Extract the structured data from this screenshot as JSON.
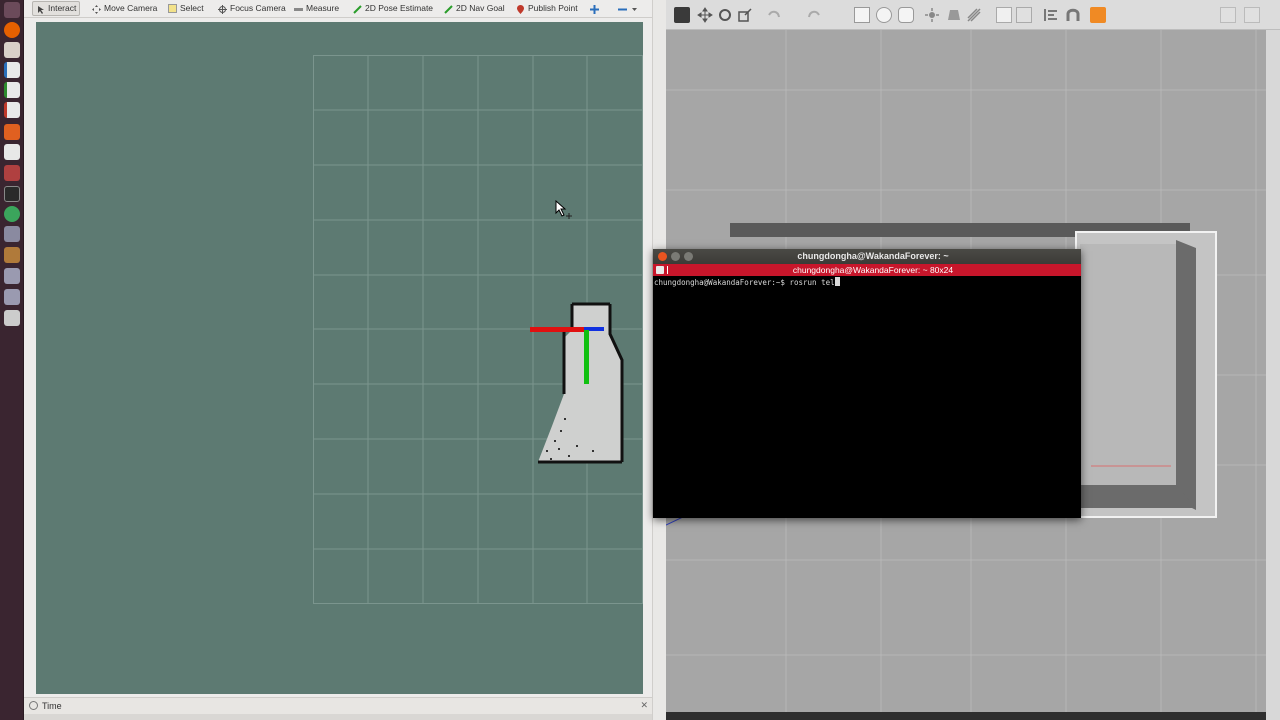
{
  "rviz": {
    "tools": [
      {
        "label": "Interact",
        "icon": "interact-icon"
      },
      {
        "label": "Move Camera",
        "icon": "move-camera-icon"
      },
      {
        "label": "Select",
        "icon": "select-icon"
      },
      {
        "label": "Focus Camera",
        "icon": "focus-camera-icon"
      },
      {
        "label": "Measure",
        "icon": "measure-icon"
      },
      {
        "label": "2D Pose Estimate",
        "icon": "pose-estimate-icon"
      },
      {
        "label": "2D Nav Goal",
        "icon": "nav-goal-icon"
      },
      {
        "label": "Publish Point",
        "icon": "publish-point-icon"
      }
    ],
    "time_panel": {
      "label": "Time"
    }
  },
  "terminal": {
    "window_title": "chungdongha@WakandaForever: ~",
    "tab_title": "chungdongha@WakandaForever: ~ 80x24",
    "prompt": "chungdongha@WakandaForever:~$ ",
    "command": "rosrun tel"
  },
  "colors": {
    "viewport_bg": "#5d7a72",
    "terminal_tab": "#c7162b",
    "axis_x": "#e01010",
    "axis_y": "#10c010",
    "axis_z": "#1030e0"
  }
}
